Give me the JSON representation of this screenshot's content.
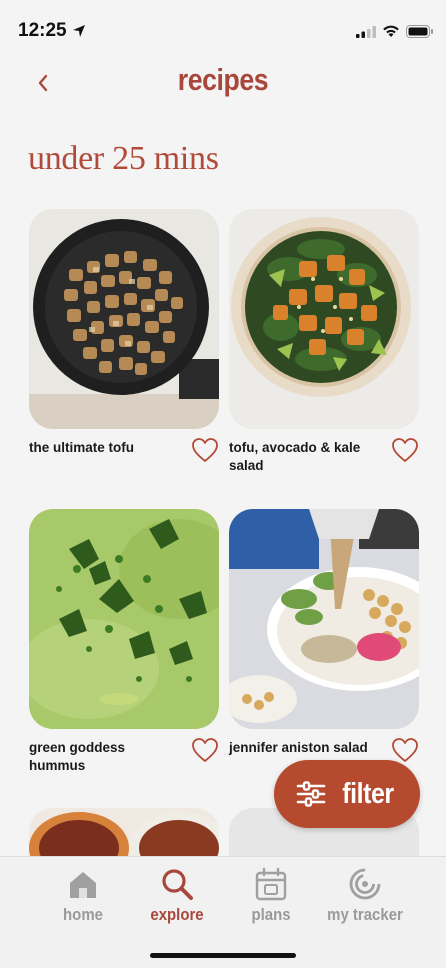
{
  "status_bar": {
    "time": "12:25"
  },
  "header": {
    "title": "recipes"
  },
  "section": {
    "title": "under 25 mins"
  },
  "recipes": [
    {
      "name": "the ultimate tofu"
    },
    {
      "name": "tofu, avocado & kale salad"
    },
    {
      "name": "green goddess hummus"
    },
    {
      "name": "jennifer aniston salad"
    },
    {
      "name": ""
    },
    {
      "name": ""
    }
  ],
  "filter": {
    "label": "filter"
  },
  "tabs": [
    {
      "label": "home",
      "icon": "house-icon",
      "active": false
    },
    {
      "label": "explore",
      "icon": "magnifier-icon",
      "active": true
    },
    {
      "label": "plans",
      "icon": "calendar-icon",
      "active": false
    },
    {
      "label": "my tracker",
      "icon": "tracker-icon",
      "active": false
    }
  ],
  "colors": {
    "accent": "#a8473b",
    "filter_bg": "#b64a2e",
    "background": "#f4f4f4",
    "inactive_tab": "#9a9a9a"
  }
}
